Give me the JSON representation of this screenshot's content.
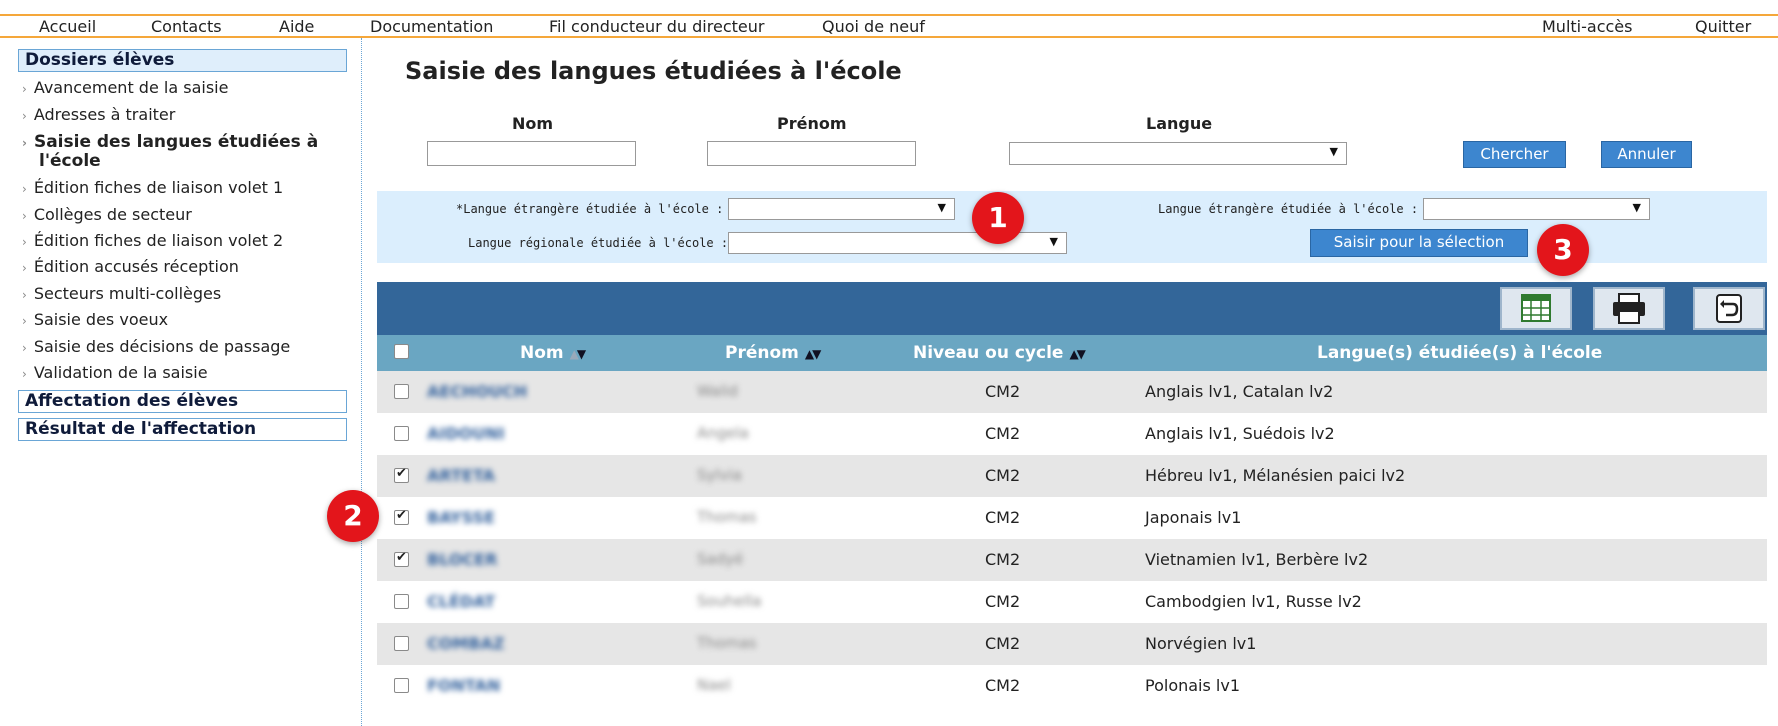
{
  "topnav": {
    "items": [
      "Accueil",
      "Contacts",
      "Aide",
      "Documentation",
      "Fil conducteur du directeur",
      "Quoi de neuf"
    ],
    "right": [
      "Multi-accès",
      "Quitter"
    ]
  },
  "sidebar": {
    "section1": "Dossiers élèves",
    "items": [
      "Avancement de la saisie",
      "Adresses à traiter",
      "Saisie des langues étudiées à l'école",
      "Édition fiches de liaison volet 1",
      "Collèges de secteur",
      "Édition fiches de liaison volet 2",
      "Édition accusés réception",
      "Secteurs multi-collèges",
      "Saisie des voeux",
      "Saisie des décisions de passage",
      "Validation de la saisie"
    ],
    "active_index": 2,
    "active_line1": "Saisie des langues étudiées à",
    "active_line2": "l'école",
    "section2": "Affectation des élèves",
    "section3": "Résultat de l'affectation"
  },
  "main": {
    "title": "Saisie des langues étudiées à l'école",
    "search": {
      "nom_label": "Nom",
      "prenom_label": "Prénom",
      "langue_label": "Langue",
      "nom_value": "",
      "prenom_value": "",
      "langue_value": "",
      "search_button": "Chercher",
      "cancel_button": "Annuler"
    },
    "filter": {
      "lang_etr_req_label": "*Langue étrangère étudiée à l'école :",
      "lang_etr_label": "Langue étrangère étudiée à l'école :",
      "lang_reg_label": "Langue régionale étudiée à l'école :",
      "apply_button": "Saisir pour la sélection"
    },
    "badges": [
      "1",
      "2",
      "3"
    ],
    "table": {
      "headers": [
        "Nom",
        "Prénom",
        "Niveau ou cycle",
        "Langue(s) étudiée(s) à l'école"
      ],
      "rows": [
        {
          "nom": "AECHOUCH",
          "prenom": "Walid",
          "niveau": "CM2",
          "langues": "Anglais lv1, Catalan lv2",
          "checked": false
        },
        {
          "nom": "AIDOUNI",
          "prenom": "Angela",
          "niveau": "CM2",
          "langues": "Anglais lv1, Suédois lv2",
          "checked": false
        },
        {
          "nom": "ARTETA",
          "prenom": "Sylvia",
          "niveau": "CM2",
          "langues": "Hébreu lv1, Mélanésien paici lv2",
          "checked": true
        },
        {
          "nom": "BAYSSE",
          "prenom": "Thomas",
          "niveau": "CM2",
          "langues": "Japonais lv1",
          "checked": true
        },
        {
          "nom": "BLOCER",
          "prenom": "Sadyé",
          "niveau": "CM2",
          "langues": "Vietnamien lv1, Berbère lv2",
          "checked": true
        },
        {
          "nom": "CLÉDAT",
          "prenom": "Souhella",
          "niveau": "CM2",
          "langues": "Cambodgien lv1, Russe lv2",
          "checked": false
        },
        {
          "nom": "COMBAZ",
          "prenom": "Thomas",
          "niveau": "CM2",
          "langues": "Norvégien lv1",
          "checked": false
        },
        {
          "nom": "FONTAN",
          "prenom": "Nael",
          "niveau": "CM2",
          "langues": "Polonais lv1",
          "checked": false
        }
      ]
    }
  },
  "colors": {
    "accent_orange": "#f5a73a",
    "toolbar_blue": "#336699",
    "header_teal": "#6aa6c2",
    "button_blue": "#3d86cf",
    "badge_red": "#e3151b",
    "filter_bg": "#dbeefd"
  },
  "icons": [
    "table-export-icon",
    "print-icon",
    "back-icon",
    "checkbox-icon",
    "sort-arrows-icon",
    "dropdown-caret-icon"
  ]
}
